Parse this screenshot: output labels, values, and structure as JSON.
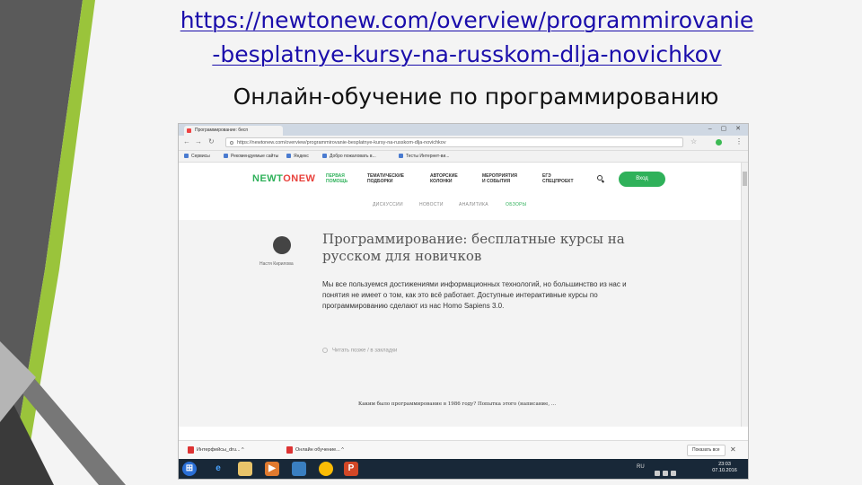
{
  "slide": {
    "url_line1": "https://newtonew.com/overview/programmirovanie",
    "url_line2": "-besplatnye-kursy-na-russkom-dlja-novichkov",
    "heading": "Онлайн-обучение по программированию"
  },
  "browser": {
    "tab_title": "Программирование: бесп",
    "address": "https://newtonew.com/overview/programmirovanie-besplatnye-kursy-na-russkom-dlja-novichkov",
    "bookmarks": [
      "Сервисы",
      "Рекомендуемые сайты",
      "Яндекс",
      "Добро пожаловать в...",
      "Тесты Интернет-ви..."
    ]
  },
  "site": {
    "logo_part1": "NEWT",
    "logo_part2": "ONEW",
    "nav": [
      {
        "line1": "ПЕРВАЯ",
        "line2": "ПОМОЩЬ"
      },
      {
        "line1": "ТЕМАТИЧЕСКИЕ",
        "line2": "ПОДБОРКИ"
      },
      {
        "line1": "АВТОРСКИЕ",
        "line2": "КОЛОНКИ"
      },
      {
        "line1": "МЕРОПРИЯТИЯ",
        "line2": "И СОБЫТИЯ"
      },
      {
        "line1": "ЕГЭ",
        "line2": "СПЕЦПРОЕКТ"
      }
    ],
    "login_label": "Вход",
    "subnav": [
      "ДИСКУССИИ",
      "НОВОСТИ",
      "АНАЛИТИКА",
      "ОБЗОРЫ"
    ]
  },
  "article": {
    "author": "Настя Кирилова",
    "title": "Программирование: бесплатные курсы на русском для новичков",
    "lead": "Мы все пользуемся достижениями информационных технологий, но большинство из нас и понятия не имеет о том, как это всё работает. Доступные интерактивные курсы по программированию сделают из нас Homo Sapiens 3.0.",
    "bookmark_link": "Читать позже / в закладки",
    "body": "Каким было программирование в 1986 году? Попытка этого (написание, ..."
  },
  "downloads": {
    "item1": "Интерфейсы_dru...",
    "item2": "Онлайн обучение...",
    "show_all": "Показать все"
  },
  "taskbar": {
    "lang": "RU",
    "time": "23:03",
    "date": "07.10.2016"
  },
  "colors": {
    "link": "#1a0dab",
    "brand_green": "#2fb15a",
    "brand_red": "#e8413b",
    "taskbar": "#182838"
  }
}
